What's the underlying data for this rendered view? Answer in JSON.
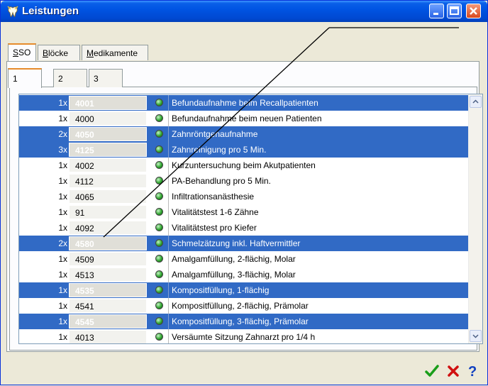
{
  "window": {
    "title": "Leistungen"
  },
  "tabs": [
    {
      "label_u": "S",
      "label_rest": "SO",
      "active": true
    },
    {
      "label_u": "B",
      "label_rest": "löcke",
      "active": false
    },
    {
      "label_u": "M",
      "label_rest": "edikamente",
      "active": false
    }
  ],
  "subtabs": [
    "1",
    "2",
    "3"
  ],
  "rows": [
    {
      "qty": "1x",
      "code": "4001",
      "desc": "Befundaufnahme beim Recallpatienten",
      "selected": true
    },
    {
      "qty": "1x",
      "code": "4000",
      "desc": "Befundaufnahme beim neuen Patienten",
      "selected": false
    },
    {
      "qty": "2x",
      "code": "4050",
      "desc": "Zahnröntgenaufnahme",
      "selected": true
    },
    {
      "qty": "3x",
      "code": "4125",
      "desc": "Zahnreinigung pro 5 Min.",
      "selected": true
    },
    {
      "qty": "1x",
      "code": "4002",
      "desc": "Kurzuntersuchung beim Akutpatienten",
      "selected": false
    },
    {
      "qty": "1x",
      "code": "4112",
      "desc": "PA-Behandlung pro 5 Min.",
      "selected": false
    },
    {
      "qty": "1x",
      "code": "4065",
      "desc": "Infiltrationsanästhesie",
      "selected": false
    },
    {
      "qty": "1x",
      "code": "91",
      "desc": "Vitalitätstest 1-6 Zähne",
      "selected": false
    },
    {
      "qty": "1x",
      "code": "4092",
      "desc": "Vitalitätstest pro Kiefer",
      "selected": false
    },
    {
      "qty": "2x",
      "code": "4580",
      "desc": "Schmelzätzung inkl. Haftvermittler",
      "selected": true
    },
    {
      "qty": "1x",
      "code": "4509",
      "desc": "Amalgamfüllung, 2-flächig, Molar",
      "selected": false
    },
    {
      "qty": "1x",
      "code": "4513",
      "desc": "Amalgamfüllung, 3-flächig, Molar",
      "selected": false
    },
    {
      "qty": "1x",
      "code": "4535",
      "desc": "Kompositfüllung, 1-flächig",
      "selected": true
    },
    {
      "qty": "1x",
      "code": "4541",
      "desc": "Kompositfüllung, 2-flächig, Prämolar",
      "selected": false
    },
    {
      "qty": "1x",
      "code": "4545",
      "desc": "Kompositfüllung, 3-flächig, Prämolar",
      "selected": true
    },
    {
      "qty": "1x",
      "code": "4013",
      "desc": "Versäumte Sitzung Zahnarzt pro 1/4 h",
      "selected": false
    }
  ],
  "colors": {
    "selection": "#316AC5",
    "status_dot": "#2FA52F",
    "accept": "#1A9E1A",
    "cancel": "#D01010",
    "help": "#1040C0"
  },
  "icons": {
    "status": "green-status-dot-icon",
    "accept": "checkmark-icon",
    "cancel": "x-icon",
    "help": "question-mark-icon"
  }
}
